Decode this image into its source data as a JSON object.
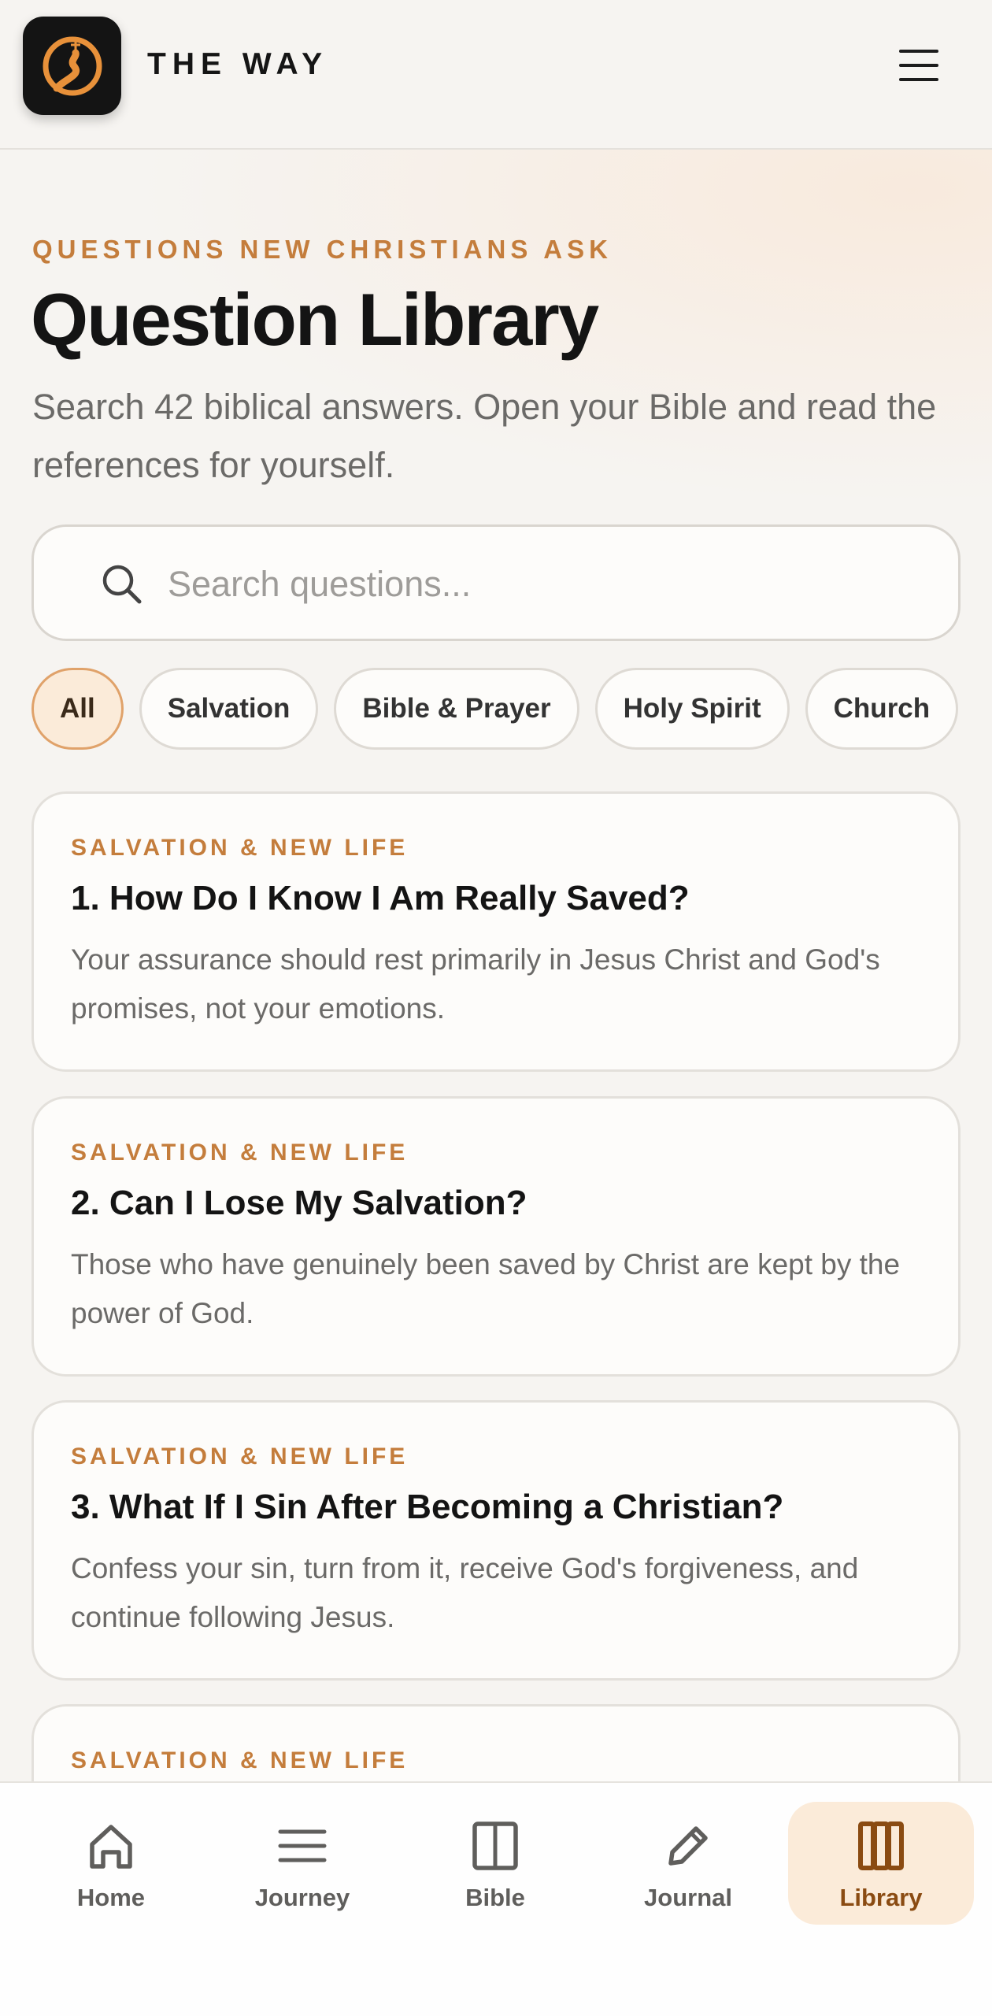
{
  "app": {
    "name": "THE WAY",
    "logo": "cross-path-logo"
  },
  "header": {
    "menu_icon": "hamburger-menu-icon"
  },
  "hero": {
    "eyebrow": "QUESTIONS NEW CHRISTIANS ASK",
    "title": "Question Library",
    "subtitle": "Search 42 biblical answers. Open your Bible and read the references for yourself."
  },
  "search": {
    "placeholder": "Search questions...",
    "value": "",
    "icon": "search-icon"
  },
  "filters": [
    {
      "label": "All",
      "active": true
    },
    {
      "label": "Salvation",
      "active": false
    },
    {
      "label": "Bible & Prayer",
      "active": false
    },
    {
      "label": "Holy Spirit",
      "active": false
    },
    {
      "label": "Church",
      "active": false
    }
  ],
  "questions": [
    {
      "category": "SALVATION & NEW LIFE",
      "title": "1. How Do I Know I Am Really Saved?",
      "summary": "Your assurance should rest primarily in Jesus Christ and God's promises, not your emotions."
    },
    {
      "category": "SALVATION & NEW LIFE",
      "title": "2. Can I Lose My Salvation?",
      "summary": "Those who have genuinely been saved by Christ are kept by the power of God."
    },
    {
      "category": "SALVATION & NEW LIFE",
      "title": "3. What If I Sin After Becoming a Christian?",
      "summary": "Confess your sin, turn from it, receive God's forgiveness, and continue following Jesus."
    },
    {
      "category": "SALVATION & NEW LIFE",
      "title": "",
      "summary": ""
    }
  ],
  "nav": [
    {
      "label": "Home",
      "icon": "home-icon",
      "active": false
    },
    {
      "label": "Journey",
      "icon": "list-icon",
      "active": false
    },
    {
      "label": "Bible",
      "icon": "book-icon",
      "active": false
    },
    {
      "label": "Journal",
      "icon": "pencil-icon",
      "active": false
    },
    {
      "label": "Library",
      "icon": "library-icon",
      "active": true
    }
  ],
  "colors": {
    "accent": "#c47d3c",
    "accent_bg": "#fbebd9",
    "background": "#f6f4f1",
    "text": "#141414",
    "muted": "#6b6a68"
  }
}
